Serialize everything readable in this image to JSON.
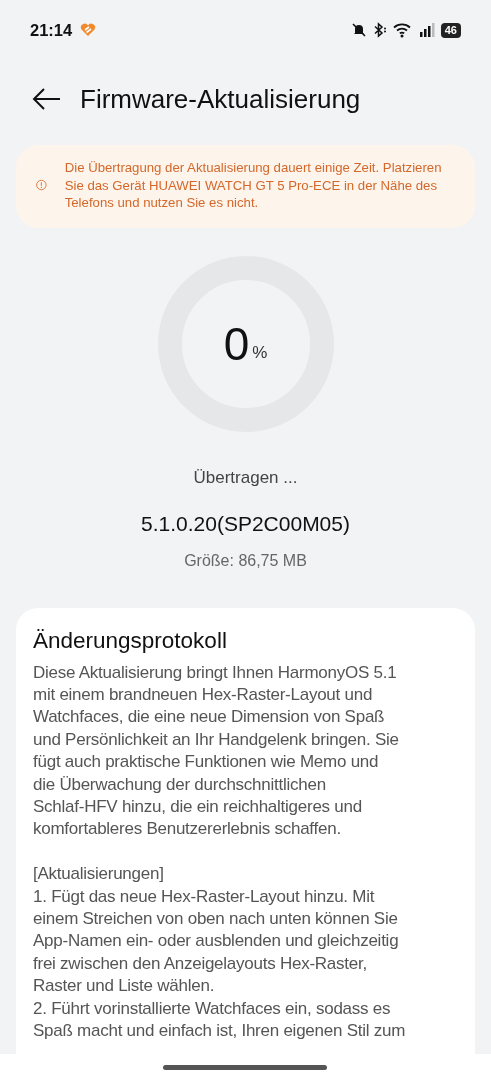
{
  "status_bar": {
    "time": "21:14",
    "battery": "46"
  },
  "header": {
    "title": "Firmware-Aktualisierung"
  },
  "notice": {
    "text": "Die Übertragung der Aktualisierung dauert einige Zeit. Platzieren Sie das Gerät HUAWEI WATCH GT 5 Pro-ECE in der Nähe des Telefons und nutzen Sie es nicht."
  },
  "progress": {
    "level": 0,
    "value": "0",
    "unit": "%",
    "status": "Übertragen ..."
  },
  "version": "5.1.0.20(SP2C00M05)",
  "size": "Größe: 86,75 MB",
  "changelog": {
    "title": "Änderungsprotokoll",
    "paragraphs": [
      [
        "Diese Aktualisierung bringt Ihnen HarmonyOS 5.1",
        "mit einem brandneuen Hex-Raster-Layout und",
        "Watchfaces, die eine neue Dimension von Spaß",
        "und Persönlichkeit an Ihr Handgelenk bringen. Sie",
        "fügt auch praktische Funktionen wie Memo und",
        "die Überwachung der durchschnittlichen",
        "Schlaf-HFV hinzu, die ein reichhaltigeres und",
        "komfortableres Benutzererlebnis schaffen."
      ],
      [
        "[Aktualisierungen]",
        "1. Fügt das neue Hex-Raster-Layout hinzu. Mit",
        "einem Streichen von oben nach unten können Sie",
        "App-Namen ein- oder ausblenden und gleichzeitig",
        "frei zwischen den Anzeigelayouts Hex-Raster,",
        "Raster und Liste wählen.",
        "2. Führt vorinstallierte Watchfaces ein, sodass es",
        "Spaß macht und einfach ist, Ihren eigenen Stil zum"
      ]
    ]
  }
}
